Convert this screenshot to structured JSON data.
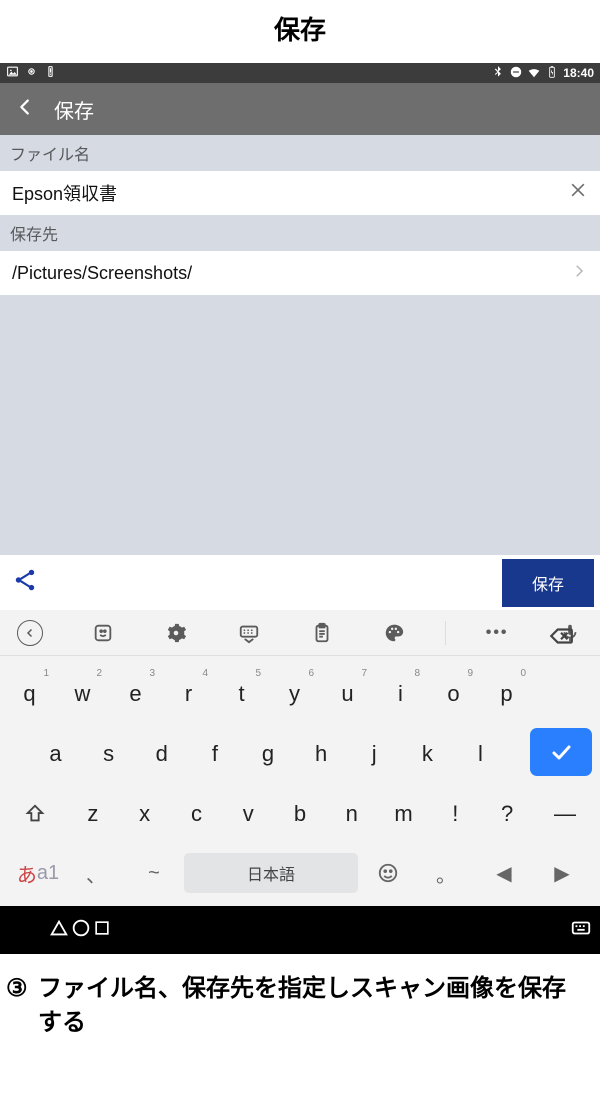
{
  "doc_title": "保存",
  "status": {
    "time": "18:40"
  },
  "appbar": {
    "title": "保存"
  },
  "sections": {
    "filename_label": "ファイル名",
    "filename_value": "Epson領収書",
    "dest_label": "保存先",
    "dest_value": "/Pictures/Screenshots/"
  },
  "actions": {
    "save_label": "保存"
  },
  "keyboard": {
    "row1": [
      {
        "k": "q",
        "s": "1"
      },
      {
        "k": "w",
        "s": "2"
      },
      {
        "k": "e",
        "s": "3"
      },
      {
        "k": "r",
        "s": "4"
      },
      {
        "k": "t",
        "s": "5"
      },
      {
        "k": "y",
        "s": "6"
      },
      {
        "k": "u",
        "s": "7"
      },
      {
        "k": "i",
        "s": "8"
      },
      {
        "k": "o",
        "s": "9"
      },
      {
        "k": "p",
        "s": "0"
      }
    ],
    "row2": [
      "a",
      "s",
      "d",
      "f",
      "g",
      "h",
      "j",
      "k",
      "l"
    ],
    "row3": [
      "z",
      "x",
      "c",
      "v",
      "b",
      "n",
      "m",
      "!",
      "?"
    ],
    "lang_switch_primary": "あ",
    "lang_switch_secondary": "a1",
    "diacritic1": "、",
    "diacritic2": "~",
    "space_label": "日本語",
    "emoji": "☺",
    "period": "。",
    "left": "◀",
    "right": "▶",
    "dash": "—"
  },
  "caption": {
    "step_marker": "③",
    "text": "ファイル名、保存先を指定しスキャン画像を保存する"
  }
}
